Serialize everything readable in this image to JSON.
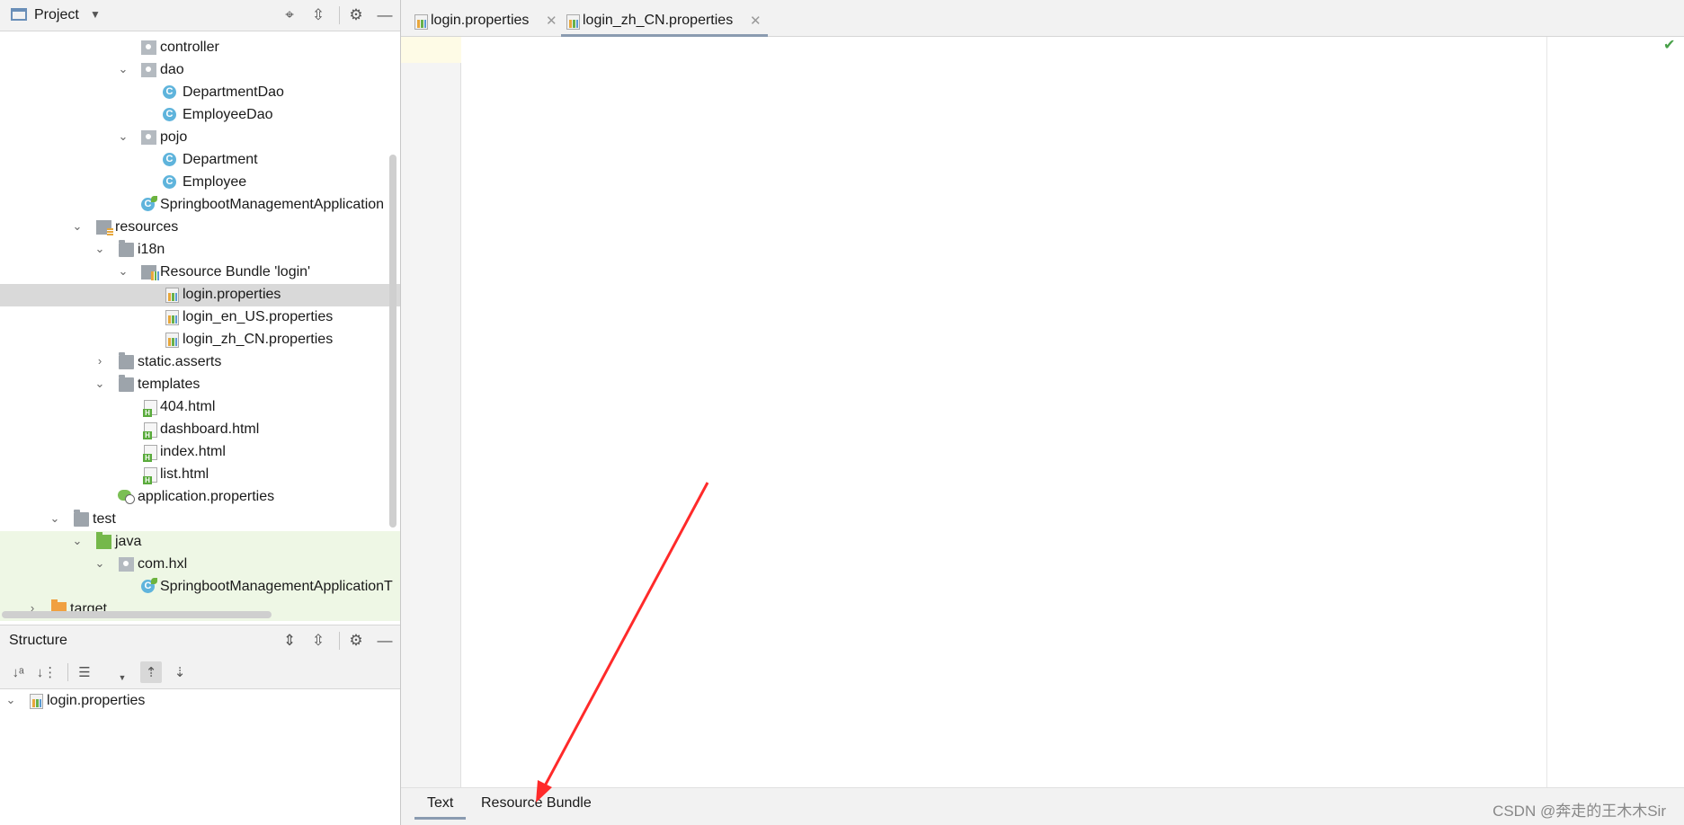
{
  "project_panel": {
    "title": "Project",
    "tree": [
      {
        "label": "controller"
      },
      {
        "label": "dao"
      },
      {
        "label": "DepartmentDao"
      },
      {
        "label": "EmployeeDao"
      },
      {
        "label": "pojo"
      },
      {
        "label": "Department"
      },
      {
        "label": "Employee"
      },
      {
        "label": "SpringbootManagementApplication"
      },
      {
        "label": "resources"
      },
      {
        "label": "i18n"
      },
      {
        "label": "Resource Bundle 'login'"
      },
      {
        "label": "login.properties"
      },
      {
        "label": "login_en_US.properties"
      },
      {
        "label": "login_zh_CN.properties"
      },
      {
        "label": "static.asserts"
      },
      {
        "label": "templates"
      },
      {
        "label": "404.html"
      },
      {
        "label": "dashboard.html"
      },
      {
        "label": "index.html"
      },
      {
        "label": "list.html"
      },
      {
        "label": "application.properties"
      },
      {
        "label": "test"
      },
      {
        "label": "java"
      },
      {
        "label": "com.hxl"
      },
      {
        "label": "SpringbootManagementApplicationT"
      },
      {
        "label": "target"
      }
    ]
  },
  "structure_panel": {
    "title": "Structure",
    "root_item": "login.properties"
  },
  "editor": {
    "tabs": [
      {
        "label": "login.properties",
        "active": false
      },
      {
        "label": "login_zh_CN.properties",
        "active": true
      }
    ],
    "bottom_tabs": [
      {
        "label": "Text",
        "active": true
      },
      {
        "label": "Resource Bundle",
        "active": false
      }
    ],
    "status_ok": "✔"
  },
  "watermark": "CSDN @奔走的王木木Sir",
  "colors": {
    "selection": "#d9d9d9",
    "test_source_bg": "#eef7e5",
    "current_line": "#fefbe6",
    "annotation_arrow": "#ff2a2a"
  }
}
